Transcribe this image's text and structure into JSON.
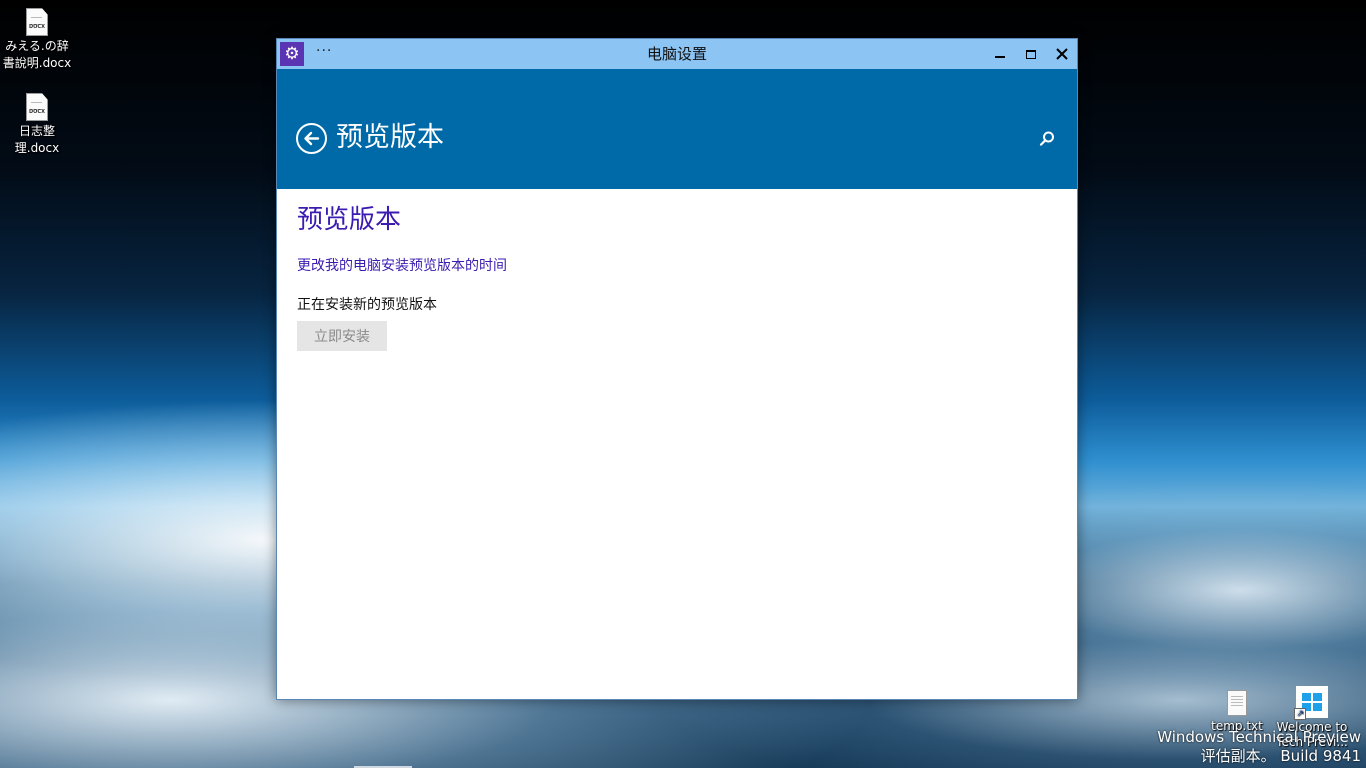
{
  "desktop": {
    "icons_left": [
      {
        "label": "みえる.の辞書說明.docx",
        "type_tag": "DOCX"
      },
      {
        "label": "日志整理.docx",
        "type_tag": "DOCX"
      }
    ],
    "icons_right": [
      {
        "label": "temp.txt"
      },
      {
        "label": "Welcome to Tech Previ..."
      }
    ],
    "watermark": {
      "line1": "Windows Technical Preview",
      "line2": "评估副本。 Build 9841"
    }
  },
  "window": {
    "title": "电脑设置",
    "menu_dots": "···",
    "header": {
      "title": "预览版本"
    },
    "content": {
      "page_title": "预览版本",
      "link_text": "更改我的电脑安装预览版本的时间",
      "status_text": "正在安装新的预览版本",
      "install_button": "立即安装"
    }
  },
  "colors": {
    "titlebar": "#8cc4f3",
    "header": "#006aa8",
    "accent": "#3b1bb0",
    "app_icon": "#5b34b4"
  }
}
